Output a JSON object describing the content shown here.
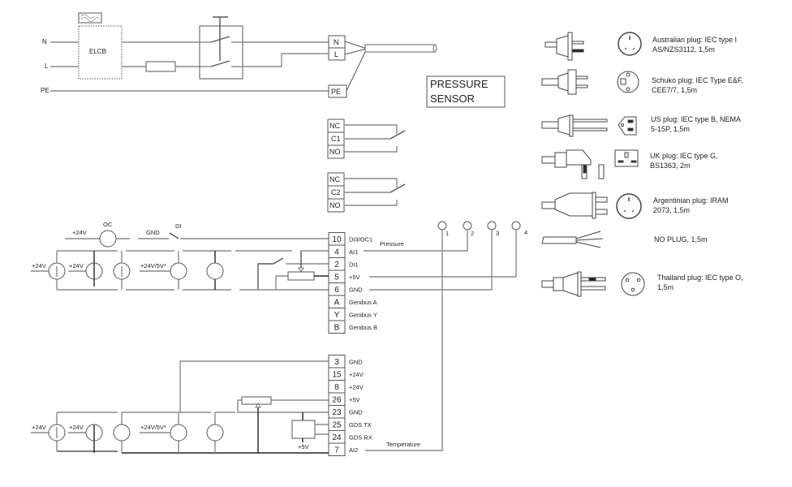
{
  "mains": {
    "n_label": "N",
    "l_label": "L",
    "pe_label": "PE",
    "elcb_label": "ELCB",
    "terminals": [
      "N",
      "L",
      "PE"
    ]
  },
  "sensor_label": {
    "line1": "PRESSURE",
    "line2": "SENSOR"
  },
  "relay1": [
    "NC",
    "C1",
    "NO"
  ],
  "relay2": [
    "NC",
    "C2",
    "NO"
  ],
  "block1": {
    "labels": {
      "p24_a": "+24V",
      "oc": "OC",
      "gnd": "GND",
      "di": "DI",
      "src1": "+24V",
      "src2": "+24V",
      "src3": "+24V/5V*"
    },
    "terminals": [
      {
        "num": "10",
        "name": "DI3/OC1"
      },
      {
        "num": "4",
        "name": "AI1"
      },
      {
        "num": "2",
        "name": "DI1"
      },
      {
        "num": "5",
        "name": "+5V"
      },
      {
        "num": "6",
        "name": "GND"
      },
      {
        "num": "A",
        "name": "Genibus A"
      },
      {
        "num": "Y",
        "name": "Genibus Y"
      },
      {
        "num": "B",
        "name": "Genibus B"
      }
    ],
    "pressure_label": "Pressure"
  },
  "sensor_pins": [
    "1",
    "2",
    "3",
    "4"
  ],
  "block2": {
    "labels": {
      "src1": "+24V",
      "src2": "+24V",
      "src3": "+24V/5V*",
      "gds_supply": "+5V"
    },
    "terminals": [
      {
        "num": "3",
        "name": "GND"
      },
      {
        "num": "15",
        "name": "+24V"
      },
      {
        "num": "8",
        "name": "+24V"
      },
      {
        "num": "26",
        "name": "+5V"
      },
      {
        "num": "23",
        "name": "GND"
      },
      {
        "num": "25",
        "name": "GDS TX"
      },
      {
        "num": "24",
        "name": "GDS RX"
      },
      {
        "num": "7",
        "name": "AI2"
      }
    ],
    "temperature_label": "Temperature"
  },
  "plugs": [
    {
      "line1": "Australian plug: IEC type I",
      "line2": "AS/NZS3112, 1,5m"
    },
    {
      "line1": "Schuko plug: IEC Type E&F,",
      "line2": "CEE7/7, 1,5m"
    },
    {
      "line1": "US plug: IEC type B, NEMA",
      "line2": "5-15P, 1,5m"
    },
    {
      "line1": "UK plug: IEC type G,",
      "line2": "BS1363, 2m"
    },
    {
      "line1": "Argentinian plug: IRAM",
      "line2": "2073, 1,5m"
    },
    {
      "line1": "NO PLUG, 1,5m",
      "line2": ""
    },
    {
      "line1": "Thailand plug: IEC type O,",
      "line2": "1,5m"
    }
  ]
}
